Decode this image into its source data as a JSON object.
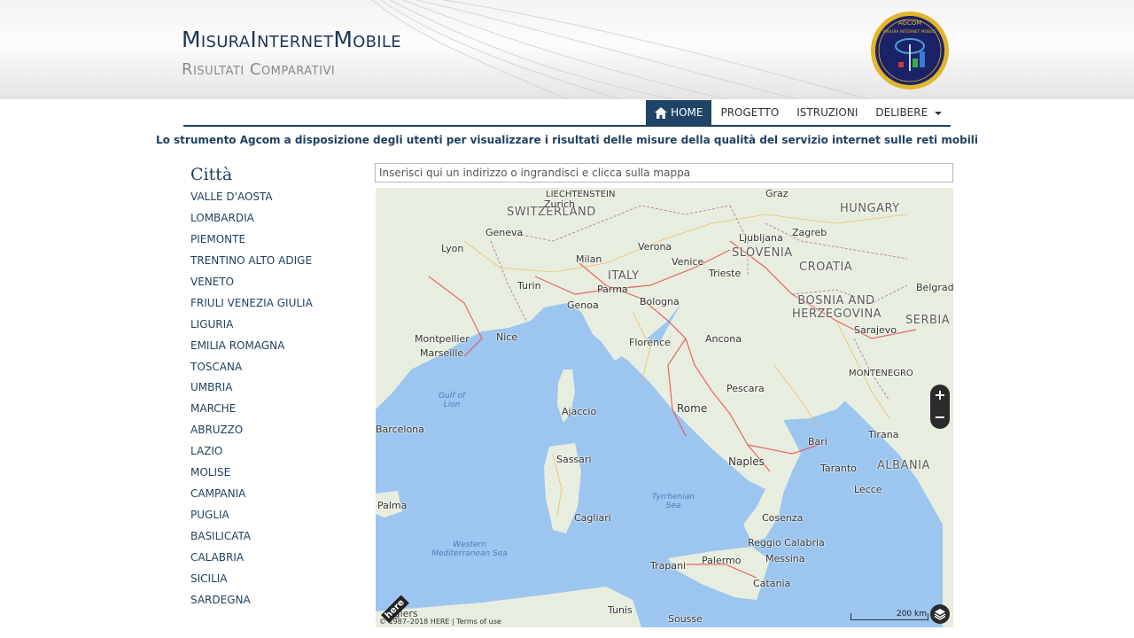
{
  "header": {
    "title": "MisuraInternetMobile",
    "subtitle": "Risultati Comparativi",
    "logo_text": "AGCOM",
    "logo_subtext": "MISURA INTERNET MOBILE"
  },
  "nav": {
    "items": [
      {
        "label": "HOME",
        "active": true
      },
      {
        "label": "PROGETTO",
        "active": false
      },
      {
        "label": "ISTRUZIONI",
        "active": false
      },
      {
        "label": "DELIBERE",
        "active": false,
        "dropdown": true
      }
    ]
  },
  "tagline": "Lo strumento Agcom a disposizione degli utenti per visualizzare i risultati delle misure della qualità del servizio internet sulle reti mobili",
  "sidebar": {
    "title": "Città",
    "regions": [
      "VALLE D'AOSTA",
      "LOMBARDIA",
      "PIEMONTE",
      "TRENTINO ALTO ADIGE",
      "VENETO",
      "FRIULI VENEZIA GIULIA",
      "LIGURIA",
      "EMILIA ROMAGNA",
      "TOSCANA",
      "UMBRIA",
      "MARCHE",
      "ABRUZZO",
      "LAZIO",
      "MOLISE",
      "CAMPANIA",
      "PUGLIA",
      "BASILICATA",
      "CALABRIA",
      "SICILIA",
      "SARDEGNA"
    ]
  },
  "search": {
    "placeholder": "Inserisci qui un indirizzo o ingrandisci e clicca sulla mappa"
  },
  "map": {
    "countries": [
      "SWITZERLAND",
      "ITALY",
      "SLOVENIA",
      "CROATIA",
      "HUNGARY",
      "BOSNIA AND HERZEGOVINA",
      "SERBIA",
      "MONTENEGRO",
      "ALBANIA",
      "LIECHTENSTEIN"
    ],
    "seas": [
      "Gulf of Lion",
      "Tyrrhenian Sea",
      "Western Mediterranean Sea"
    ],
    "cities": [
      "Milan",
      "Turin",
      "Genoa",
      "Bologna",
      "Florence",
      "Venice",
      "Rome",
      "Naples",
      "Bari",
      "Palermo",
      "Catania",
      "Cagliari",
      "Sassari",
      "Ajaccio",
      "Nice",
      "Marseille",
      "Montpellier",
      "Lyon",
      "Geneva",
      "Zurich",
      "Ljubljana",
      "Zagreb",
      "Sarajevo",
      "Belgrade",
      "Tirana",
      "Algiers",
      "Tunis",
      "Palma",
      "Barcelona",
      "Graz",
      "Trieste",
      "Ancona",
      "Pescara",
      "Taranto",
      "Lecce",
      "Messina",
      "Cosenza",
      "Reggio Calabria",
      "Trapani",
      "Sousse",
      "Verona",
      "Parma"
    ],
    "scale_label": "200 km",
    "attribution": "© 1987–2018 HERE | Terms of use",
    "brand": "here",
    "colors": {
      "sea": "#9cc5f0",
      "land": "#e8eedf",
      "road_major": "#e94b4b",
      "road_minor": "#f0b24a"
    }
  },
  "zoom": {
    "in": "+",
    "out": "−"
  },
  "colors": {
    "accent": "#1f4466",
    "text_dark": "#1f3f5f"
  }
}
